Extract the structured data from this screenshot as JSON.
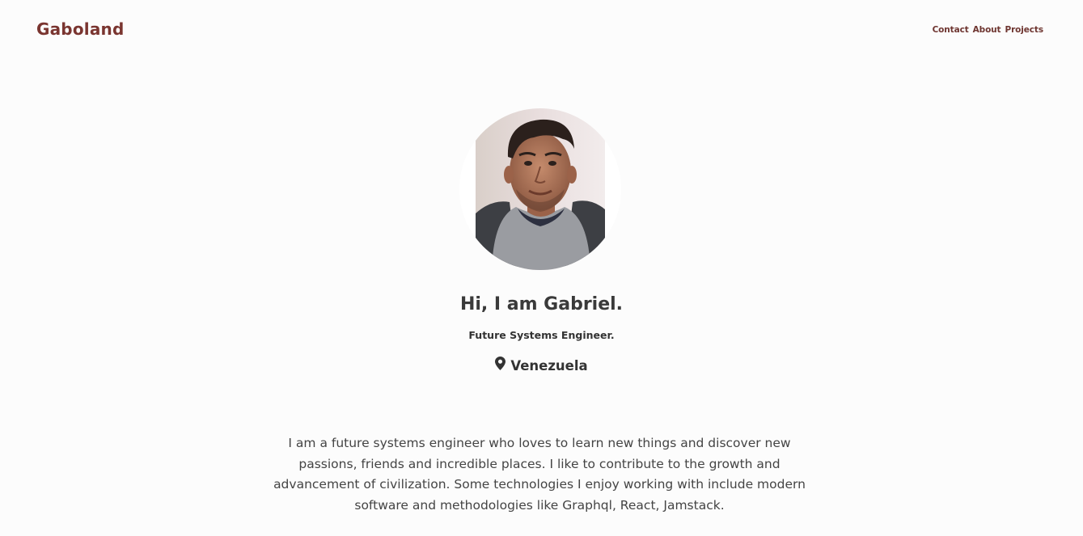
{
  "header": {
    "brand": "Gaboland",
    "nav": [
      {
        "label": "Contact"
      },
      {
        "label": "About"
      },
      {
        "label": "Projects"
      }
    ]
  },
  "profile": {
    "avatar_alt": "profile-photo",
    "greeting": "Hi, I am Gabriel.",
    "subtitle": "Future Systems Engineer.",
    "location_icon": "map-pin-icon",
    "location": "Venezuela"
  },
  "about": {
    "bio": "I am a future systems engineer who loves to learn new things and discover new passions, friends and incredible places. I like to contribute to the growth and advancement of civilization. Some technologies I enjoy working with include modern software and methodologies like Graphql, React, Jamstack."
  },
  "colors": {
    "brand": "#7a3530",
    "background": "#fcfcfc",
    "text": "#3a3a3a"
  }
}
